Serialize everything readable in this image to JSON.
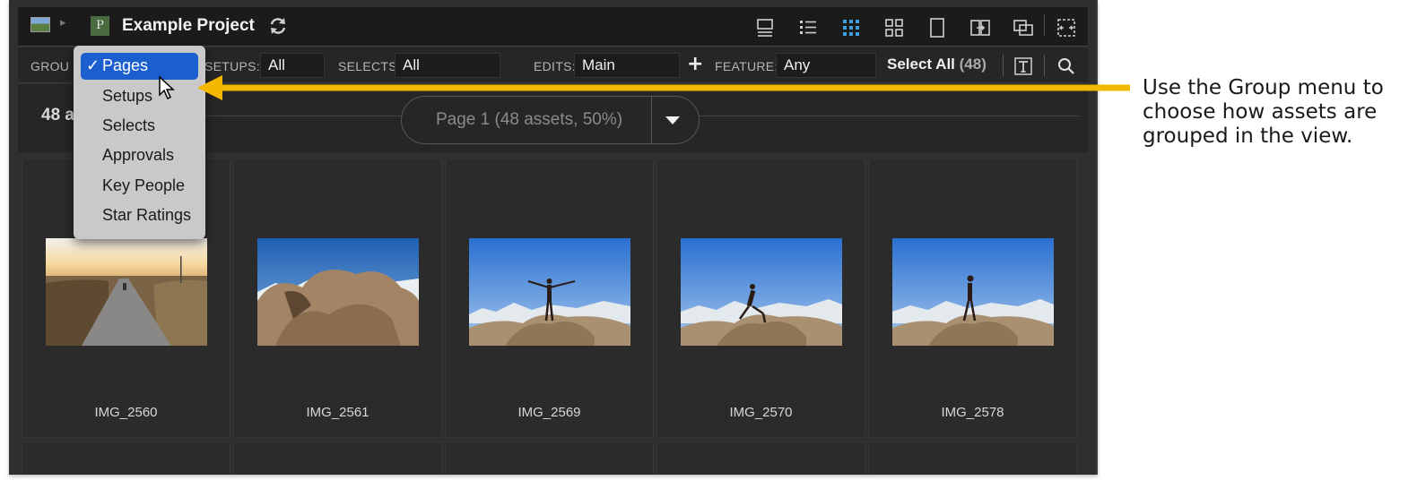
{
  "titlebar": {
    "project_badge": "P",
    "project_title": "Example Project"
  },
  "filters": {
    "group_label": "GROU",
    "setups_label": "SETUPS:",
    "setups_value": "All",
    "selects_label": "SELECTS:",
    "selects_value": "All",
    "edits_label": "EDITS:",
    "edits_value": "Main",
    "add_label": "+",
    "feature_label": "FEATURE:",
    "feature_value": "Any",
    "select_all_label": "Select All",
    "select_all_count": "(48)"
  },
  "subheader": {
    "asset_count": "48 a",
    "pager_text": "Page 1  (48 assets, 50%)"
  },
  "group_menu": {
    "items": [
      {
        "label": "Pages",
        "selected": true
      },
      {
        "label": "Setups",
        "selected": false
      },
      {
        "label": "Selects",
        "selected": false
      },
      {
        "label": "Approvals",
        "selected": false
      },
      {
        "label": "Key People",
        "selected": false
      },
      {
        "label": "Star Ratings",
        "selected": false
      }
    ],
    "check_glyph": "✓"
  },
  "assets": [
    {
      "name": "IMG_2560",
      "scene": "road"
    },
    {
      "name": "IMG_2561",
      "scene": "rocks"
    },
    {
      "name": "IMG_2569",
      "scene": "arms-out"
    },
    {
      "name": "IMG_2570",
      "scene": "lunge"
    },
    {
      "name": "IMG_2578",
      "scene": "standing"
    }
  ],
  "annotation": {
    "text": "Use the Group menu to\nchoose how assets are\ngrouped in the view.",
    "arrow_color": "#f5b800"
  },
  "colors": {
    "active_view_icon": "#3fa0e0",
    "menu_selected": "#1b5fcf"
  }
}
